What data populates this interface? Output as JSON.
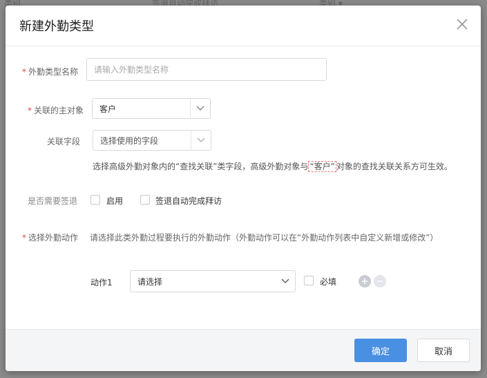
{
  "backdrop": {
    "text_left": "类别",
    "text_mid": "签退自动完成拜访",
    "text_right": "类别 ▾"
  },
  "dialog": {
    "title": "新建外勤类型",
    "fields": {
      "type_name": {
        "required": true,
        "label": "外勤类型名称",
        "placeholder": "请输入外勤类型名称",
        "value": ""
      },
      "main_object": {
        "required": true,
        "label": "关联的主对象",
        "value": "客户"
      },
      "related_field": {
        "label": "关联字段",
        "value": "选择使用的字段"
      },
      "hint": {
        "before": "选择高级外勤对象内的“查找关联”类字段，高级外勤对象与",
        "highlight": "“客户”",
        "after": "对象的查找关联关系方可生效。"
      },
      "checkout": {
        "label": "是否需要签退",
        "enable_label": "启用",
        "auto_label": "签退自动完成拜访",
        "enable_checked": false,
        "auto_checked": false
      },
      "actions": {
        "required": true,
        "label": "选择外勤动作",
        "description": "请选择此类外勤过程要执行的外勤动作（外勤动作可以在“外勤动作列表中自定义新增或修改”）"
      },
      "action1": {
        "label": "动作1",
        "value": "请选择",
        "required_label": "必填",
        "required_checked": false
      }
    },
    "buttons": {
      "confirm": "确定",
      "cancel": "取消"
    },
    "colors": {
      "primary": "#4a90e2",
      "required": "#e84a4a"
    }
  }
}
